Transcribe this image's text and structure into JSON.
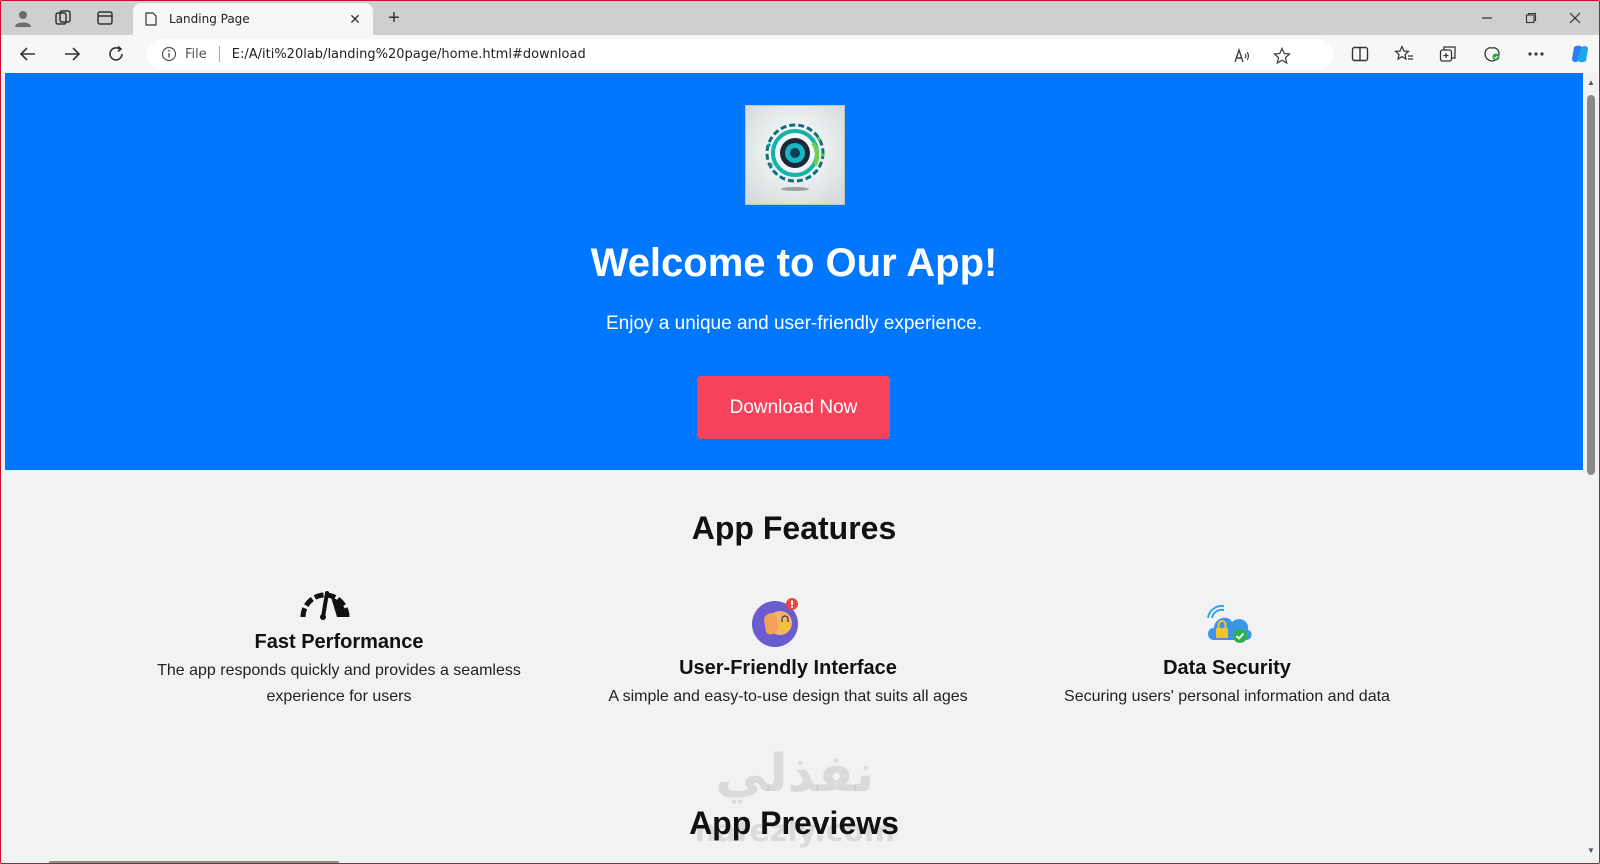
{
  "browser": {
    "tab": {
      "title": "Landing Page",
      "icon": "page-icon"
    },
    "address": {
      "scheme_label": "File",
      "url": "E:/A/iti%20lab/landing%20page/home.html#download"
    }
  },
  "hero": {
    "logo": "app-logo",
    "title": "Welcome to Our App!",
    "subtitle": "Enjoy a unique and user-friendly experience.",
    "cta_label": "Download Now"
  },
  "features": {
    "heading": "App Features",
    "items": [
      {
        "icon": "speedometer-icon",
        "title": "Fast Performance",
        "description": "The app responds quickly and provides a seamless experience for users"
      },
      {
        "icon": "touch-interface-icon",
        "title": "User-Friendly Interface",
        "description": "A simple and easy-to-use design that suits all ages"
      },
      {
        "icon": "cloud-lock-icon",
        "title": "Data Security",
        "description": "Securing users' personal information and data"
      }
    ]
  },
  "previews": {
    "heading": "App Previews"
  },
  "watermark": "نفذلي\nnafezly.com",
  "colors": {
    "hero_bg": "#0177fe",
    "cta_bg": "#f6435b",
    "page_bg": "#f2f2f4"
  }
}
